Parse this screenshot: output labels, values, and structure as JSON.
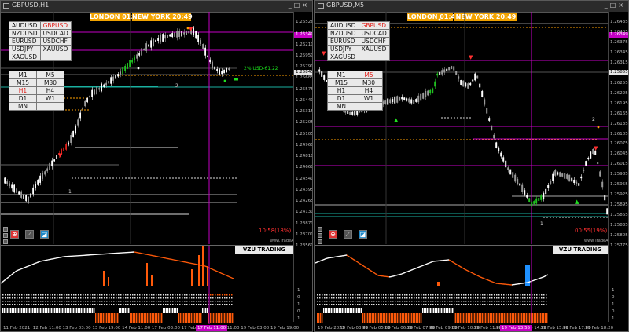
{
  "windows": [
    {
      "id": "w1",
      "title": "GBPUSD,H1",
      "session": {
        "london": "LONDON  01:49",
        "newyork": "NEW YORK  20:49"
      },
      "symbols": [
        [
          "AUDUSD",
          "GBPUSD"
        ],
        [
          "NZDUSD",
          "USDCAD"
        ],
        [
          "EURUSD",
          "USDCHF"
        ],
        [
          "USDJPY",
          "XAUUSD"
        ],
        [
          "XAGUSD",
          ""
        ]
      ],
      "timeframes": [
        [
          "M1",
          "M5"
        ],
        [
          "M15",
          "M30"
        ],
        [
          "H1",
          "H4"
        ],
        [
          "D1",
          "W1"
        ],
        [
          "MN",
          ""
        ]
      ],
      "active_symbol": "GBPUSD",
      "active_tf": "H1",
      "price_labels": [
        "1.26526",
        "1.26480",
        "1.26210",
        "1.25950",
        "1.25790",
        "1.25685",
        "1.25575",
        "1.25440",
        "1.25315",
        "1.25205",
        "1.25105",
        "1.24960",
        "1.24810",
        "1.24660",
        "1.24540",
        "1.24395",
        "1.24265",
        "1.24130",
        "1.23870",
        "1.23700",
        "1.23560"
      ],
      "badges": [
        {
          "text": "1.26349",
          "color": "#c400c4"
        },
        {
          "text": "1.25845",
          "color": "#e6e6e6"
        }
      ],
      "annotation": "2% USD-61.22",
      "percent": "10:58(18%)",
      "site": "www.TradeAll.com",
      "vzu": "VZU TRADING SYSTEM",
      "time_labels": [
        "11 Feb 2021",
        "12 Feb 11:00",
        "13 Feb 03:00",
        "13 Feb 19:00",
        "14 Feb 11:00",
        "17 Feb 03:00",
        "17 Feb 19:00",
        "18 Feb 11:00",
        "19 Feb 03:00",
        "19 Feb 19:00"
      ],
      "time_badge": "17 Feb 11:00",
      "sub_levels": [
        "1",
        "0",
        "1",
        "0",
        "1"
      ],
      "marks": [
        "1",
        "2"
      ],
      "colors": {
        "session": "#f2a300",
        "trend_up": "#ffffff",
        "trend_down": "#ff5a0a",
        "magenta": "#c400c4"
      }
    },
    {
      "id": "w2",
      "title": "GBPUSD,M5",
      "session": {
        "london": "LONDON  01:49",
        "newyork": "NEW YORK  20:49"
      },
      "symbols": [
        [
          "AUDUSD",
          "GBPUSD"
        ],
        [
          "NZDUSD",
          "USDCAD"
        ],
        [
          "EURUSD",
          "USDCHF"
        ],
        [
          "USDJPY",
          "XAUUSD"
        ],
        [
          "XAGUSD",
          ""
        ]
      ],
      "timeframes": [
        [
          "M1",
          "M5"
        ],
        [
          "M15",
          "M30"
        ],
        [
          "H1",
          "H4"
        ],
        [
          "D1",
          "W1"
        ],
        [
          "MN",
          ""
        ]
      ],
      "active_symbol": "GBPUSD",
      "active_tf": "M5",
      "price_labels": [
        "1.26435",
        "1.26405",
        "1.26375",
        "1.26345",
        "1.26315",
        "1.26285",
        "1.26255",
        "1.26225",
        "1.26195",
        "1.26165",
        "1.26135",
        "1.26105",
        "1.26075",
        "1.26045",
        "1.26015",
        "1.25985",
        "1.25955",
        "1.25925",
        "1.25895",
        "1.25865",
        "1.25835",
        "1.25805",
        "1.25775"
      ],
      "badges": [
        {
          "text": "1.26349",
          "color": "#c400c4"
        },
        {
          "text": "1.25855",
          "color": "#e6e6e6"
        }
      ],
      "annotation": "",
      "percent": "00:55(19%)",
      "site": "www.TradeAll.com",
      "vzu": "VZU TRADING SYSTEM",
      "time_labels": [
        "19 Feb 2021",
        "19 Feb 03:40",
        "19 Feb 05:00",
        "19 Feb 06:20",
        "19 Feb 07:40",
        "19 Feb 09:00",
        "19 Feb 10:20",
        "19 Feb 11:40",
        "19 Feb 13:00",
        "19 Feb 14:20",
        "19 Feb 15:40",
        "19 Feb 17:00",
        "19 Feb 18:20"
      ],
      "time_badge": "19 Feb 13:55",
      "sub_levels": [
        "1",
        "0",
        "1",
        "0",
        "1"
      ],
      "marks": [
        "1",
        "2"
      ],
      "colors": {
        "session": "#f2a300",
        "trend_up": "#ffffff",
        "trend_down": "#ff5a0a",
        "magenta": "#c400c4"
      }
    }
  ]
}
